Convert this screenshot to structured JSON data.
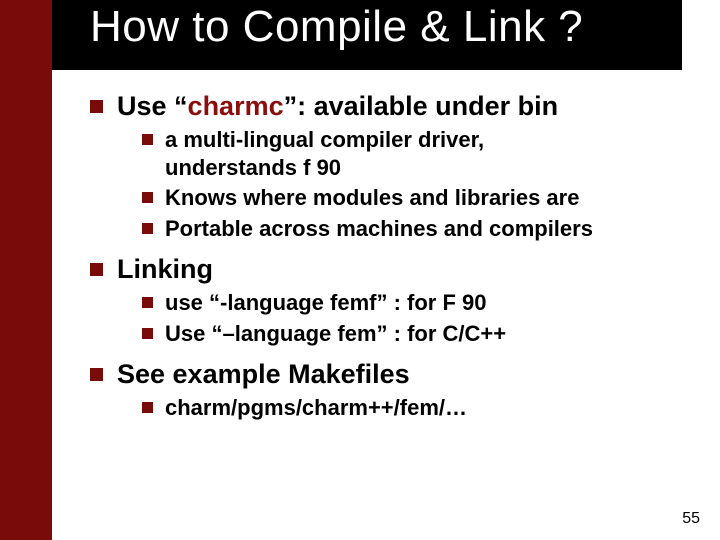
{
  "title": "How to Compile & Link ?",
  "points": {
    "p1": {
      "prefix": "Use “",
      "accent": "charmc",
      "suffix": "”: available under bin",
      "sub": [
        "a multi-lingual compiler driver, understands f 90",
        "Knows where modules and libraries are",
        "Portable across machines and compilers"
      ]
    },
    "p2": {
      "text": "Linking",
      "sub": [
        "use “-language femf” : for F 90",
        "Use “–language fem” : for C/C++"
      ]
    },
    "p3": {
      "text": "See example Makefiles",
      "sub": [
        "charm/pgms/charm++/fem/…"
      ]
    }
  },
  "page_number": "55"
}
